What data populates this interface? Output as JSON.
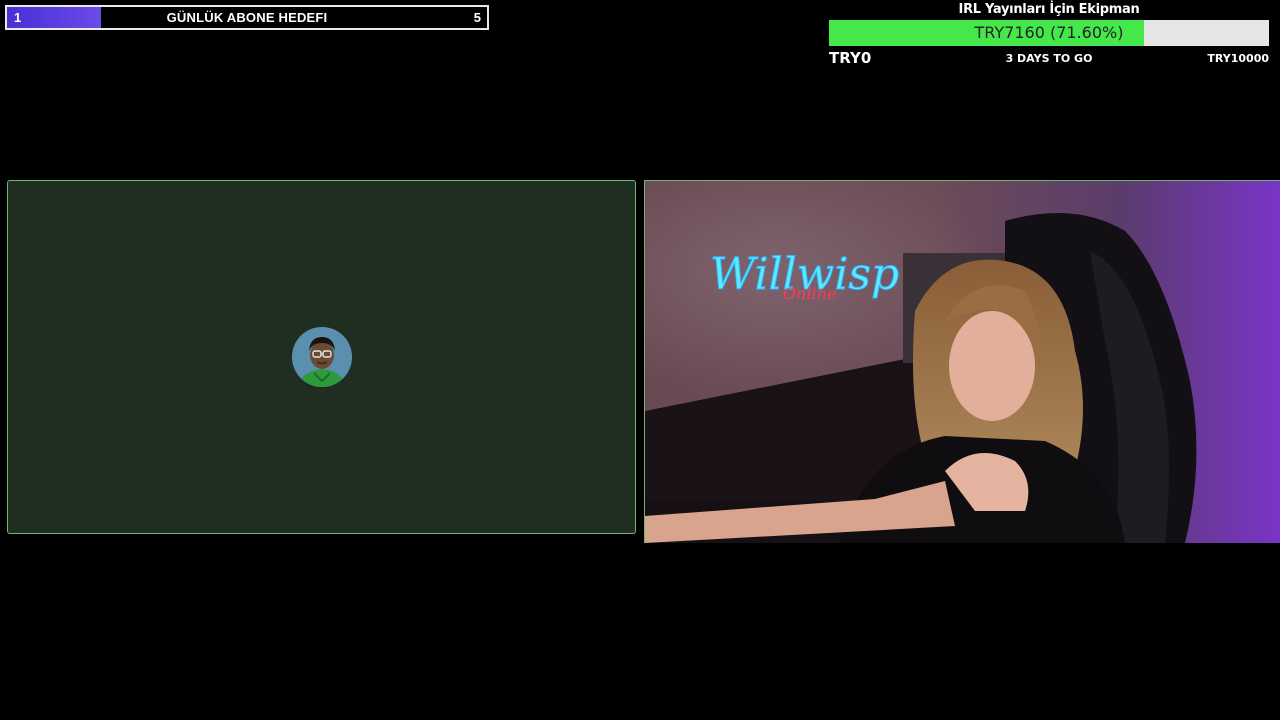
{
  "sub_goal": {
    "current": "1",
    "title": "GÜNLÜK ABONE HEDEFI",
    "target": "5",
    "progress_fraction": 0.2,
    "fill_color": "#5a3de0"
  },
  "donation_goal": {
    "title": "IRL Yayınları İçin Ekipman",
    "amount_label": "TRY7160 (71.60%)",
    "progress_percent": 71.6,
    "start_label": "TRY0",
    "remaining_label": "3 DAYS TO GO",
    "end_label": "TRY10000",
    "fill_color": "#44e84a"
  },
  "panels": {
    "guest_icon": "avatar",
    "webcam_icon": "webcam-video"
  }
}
